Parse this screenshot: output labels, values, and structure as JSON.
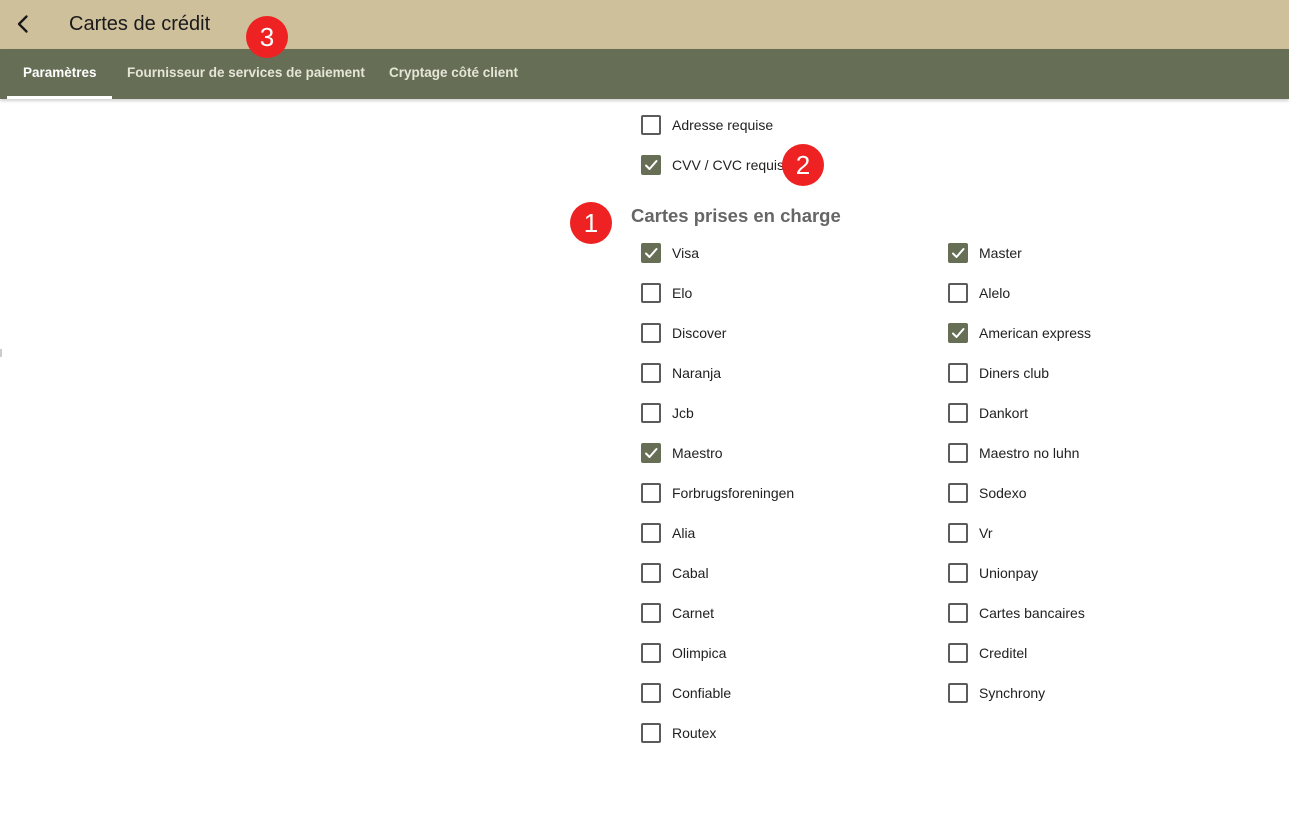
{
  "header": {
    "title": "Cartes de crédit",
    "back_icon": "arrow-back-icon"
  },
  "tabs": [
    {
      "label": "Paramètres",
      "active": true
    },
    {
      "label": "Fournisseur de services de paiement",
      "active": false
    },
    {
      "label": "Cryptage côté client",
      "active": false
    }
  ],
  "options": [
    {
      "label": "Adresse requise",
      "checked": false
    },
    {
      "label": "CVV / CVC requis",
      "checked": true
    }
  ],
  "supported_cards": {
    "title": "Cartes prises en charge",
    "left": [
      {
        "label": "Visa",
        "checked": true
      },
      {
        "label": "Elo",
        "checked": false
      },
      {
        "label": "Discover",
        "checked": false
      },
      {
        "label": "Naranja",
        "checked": false
      },
      {
        "label": "Jcb",
        "checked": false
      },
      {
        "label": "Maestro",
        "checked": true
      },
      {
        "label": "Forbrugsforeningen",
        "checked": false
      },
      {
        "label": "Alia",
        "checked": false
      },
      {
        "label": "Cabal",
        "checked": false
      },
      {
        "label": "Carnet",
        "checked": false
      },
      {
        "label": "Olimpica",
        "checked": false
      },
      {
        "label": "Confiable",
        "checked": false
      },
      {
        "label": "Routex",
        "checked": false
      }
    ],
    "right": [
      {
        "label": "Master",
        "checked": true
      },
      {
        "label": "Alelo",
        "checked": false
      },
      {
        "label": "American express",
        "checked": true
      },
      {
        "label": "Diners club",
        "checked": false
      },
      {
        "label": "Dankort",
        "checked": false
      },
      {
        "label": "Maestro no luhn",
        "checked": false
      },
      {
        "label": "Sodexo",
        "checked": false
      },
      {
        "label": "Vr",
        "checked": false
      },
      {
        "label": "Unionpay",
        "checked": false
      },
      {
        "label": "Cartes bancaires",
        "checked": false
      },
      {
        "label": "Creditel",
        "checked": false
      },
      {
        "label": "Synchrony",
        "checked": false
      }
    ]
  },
  "annotations": [
    "1",
    "2",
    "3"
  ],
  "colors": {
    "appbar": "#cfc09c",
    "tabbar": "#666f55",
    "checkbox_checked": "#666f55",
    "badge": "#ee2222"
  }
}
